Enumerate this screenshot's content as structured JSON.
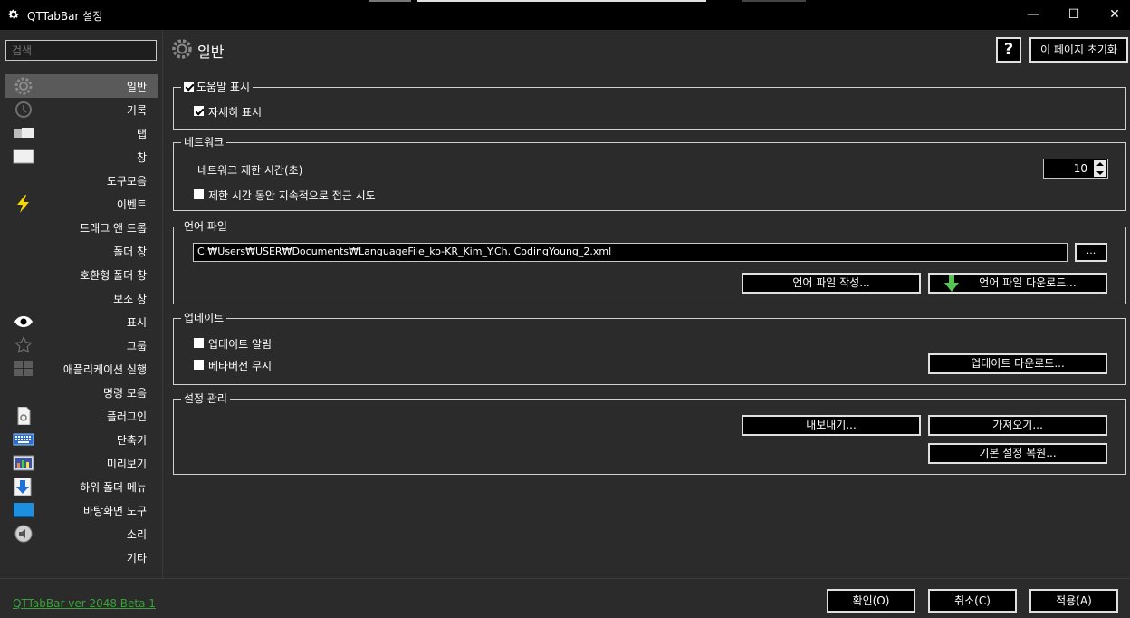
{
  "window": {
    "title": "QTTabBar 설정",
    "minimize_symbol": "—",
    "maximize_symbol": "☐",
    "close_symbol": "✕"
  },
  "sidebar": {
    "search_placeholder": "검색",
    "items": [
      {
        "label": "일반",
        "icon": "gear-icon",
        "active": true
      },
      {
        "label": "기록",
        "icon": "clock-icon"
      },
      {
        "label": "탭",
        "icon": "tab-icon"
      },
      {
        "label": "창",
        "icon": "window-icon"
      },
      {
        "label": "도구모음",
        "icon": ""
      },
      {
        "label": "이벤트",
        "icon": "lightning-icon"
      },
      {
        "label": "드래그 앤 드롭",
        "icon": ""
      },
      {
        "label": "폴더 창",
        "icon": ""
      },
      {
        "label": "호환형 폴더 창",
        "icon": ""
      },
      {
        "label": "보조 창",
        "icon": ""
      },
      {
        "label": "표시",
        "icon": "eye-icon"
      },
      {
        "label": "그룹",
        "icon": "star-icon"
      },
      {
        "label": "애플리케이션 실행",
        "icon": "windows-icon"
      },
      {
        "label": "명령 모음",
        "icon": ""
      },
      {
        "label": "플러그인",
        "icon": "plugin-icon"
      },
      {
        "label": "단축키",
        "icon": "keyboard-icon"
      },
      {
        "label": "미리보기",
        "icon": "preview-icon"
      },
      {
        "label": "하위 폴더 메뉴",
        "icon": "download-arrow-icon"
      },
      {
        "label": "바탕화면 도구",
        "icon": "desktop-icon"
      },
      {
        "label": "소리",
        "icon": "speaker-icon"
      },
      {
        "label": "기타",
        "icon": ""
      }
    ]
  },
  "header": {
    "title": "일반",
    "help_label": "?",
    "reset_label": "이 페이지 초기화"
  },
  "help_group": {
    "legend": "도움말 표시",
    "legend_checked": true,
    "detail_label": "자세히 표시",
    "detail_checked": true
  },
  "network_group": {
    "legend": "네트워크",
    "timeout_label": "네트워크 제한 시간(초)",
    "timeout_value": "10",
    "retry_label": "제한 시간 동안 지속적으로 접근 시도",
    "retry_checked": false
  },
  "language_group": {
    "legend": "언어 파일",
    "path": "C:₩Users₩USER₩Documents₩LanguageFile_ko-KR_Kim_Y.Ch. CodingYoung_2.xml",
    "browse_label": "...",
    "create_label": "언어 파일 작성...",
    "download_label": "언어 파일 다운로드..."
  },
  "update_group": {
    "legend": "업데이트",
    "notify_label": "업데이트 알림",
    "notify_checked": false,
    "ignore_beta_label": "베타버전 무시",
    "ignore_beta_checked": false,
    "download_label": "업데이트 다운로드..."
  },
  "config_group": {
    "legend": "설정 관리",
    "export_label": "내보내기...",
    "import_label": "가져오기...",
    "restore_label": "기본 설정 복원..."
  },
  "footer": {
    "version": "QTTabBar ver 2048 Beta 1",
    "ok_label": "확인(O)",
    "cancel_label": "취소(C)",
    "apply_label": "적용(A)"
  },
  "colors": {
    "background": "#2b2b2b",
    "titlebar": "#000000",
    "active_item": "#5a5a5a",
    "link": "#3aa03a",
    "button_border": "#e0e0e0"
  }
}
